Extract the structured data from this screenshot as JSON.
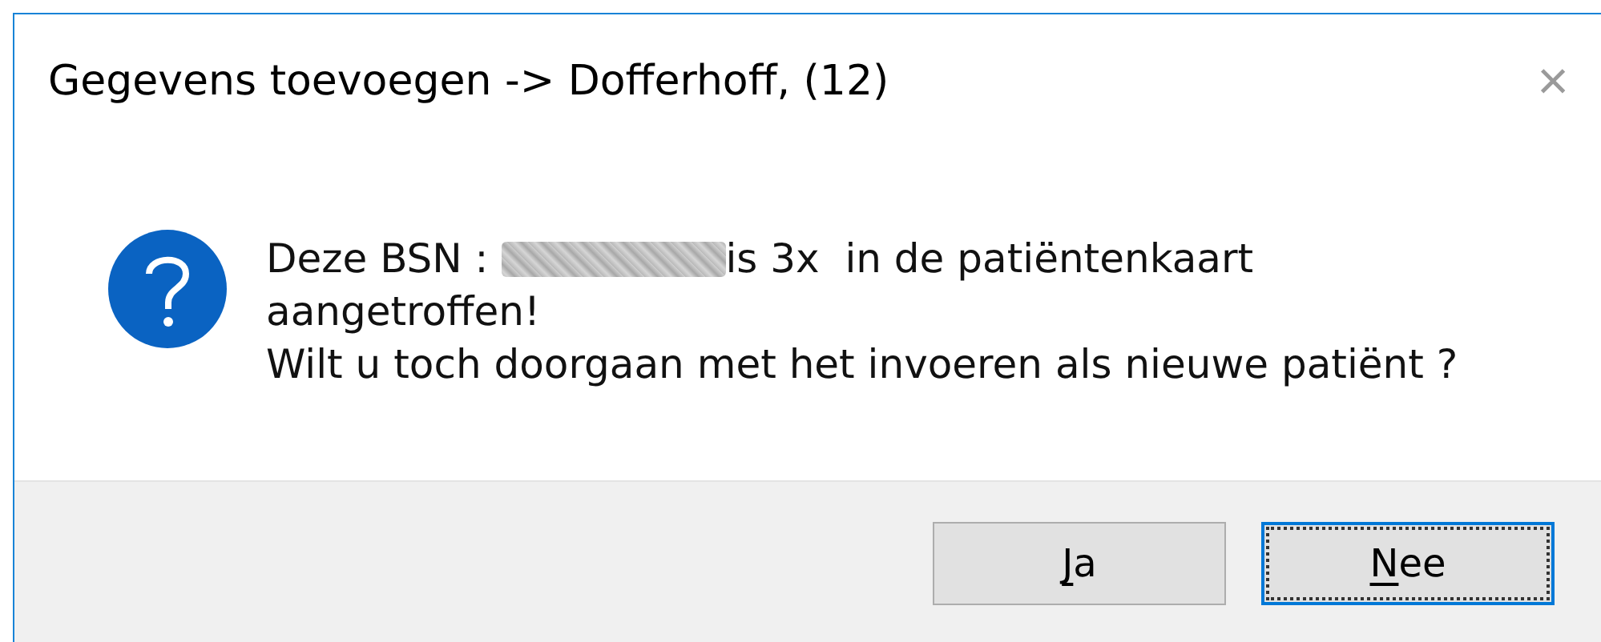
{
  "window": {
    "title": "Gegevens toevoegen -> Dofferhoff, (12)",
    "close": "×"
  },
  "message": {
    "lines": [
      {
        "segments": [
          {
            "kind": "text",
            "text": "Deze BSN : "
          },
          {
            "kind": "redacted"
          },
          {
            "kind": "text",
            "text": "is 3x  in de patiëntenkaart"
          }
        ]
      },
      {
        "segments": [
          {
            "kind": "text",
            "text": "aangetroffen!"
          }
        ]
      },
      {
        "segments": [
          {
            "kind": "text",
            "text": "Wilt u toch doorgaan met het invoeren als nieuwe patiënt ?"
          }
        ]
      }
    ]
  },
  "buttons": [
    {
      "parts": [
        {
          "text": "J",
          "underlined": true
        },
        {
          "text": "a",
          "underlined": false
        }
      ],
      "focused": false
    },
    {
      "parts": [
        {
          "text": "N",
          "underlined": true
        },
        {
          "text": "ee",
          "underlined": false
        }
      ],
      "focused": true
    }
  ]
}
